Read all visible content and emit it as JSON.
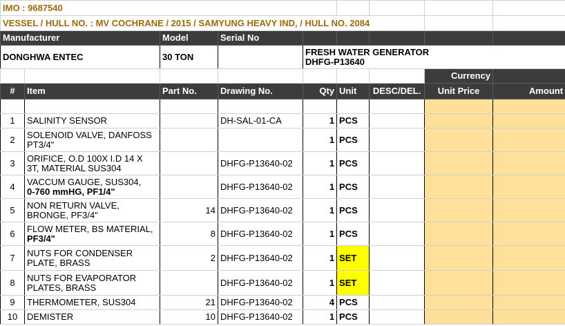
{
  "header": {
    "imo": "IMO : 9687540",
    "vessel": "VESSEL / HULL NO. : MV COCHRANE / 2015 / SAMYUNG HEAVY IND, / HULL NO. 2084"
  },
  "equipment_headers": {
    "manufacturer": "Manufacturer",
    "model": "Model",
    "serial": "Serial No"
  },
  "equipment": {
    "manufacturer": "DONGHWA ENTEC",
    "model": "30 TON",
    "serial": "",
    "description_line1": "FRESH WATER GENERATOR",
    "description_line2": "DHFG-P13640"
  },
  "currency_label": "Currency",
  "columns": {
    "num": "#",
    "item": "Item",
    "part": "Part No.",
    "drawing": "Drawing No.",
    "qty": "Qty",
    "unit": "Unit",
    "desc": "DESC/DEL.",
    "unit_price": "Unit Price",
    "amount": "Amount"
  },
  "rows": [
    {
      "num": "1",
      "item_line1": "SALINITY SENSOR",
      "item_line2": "",
      "part": "",
      "drawing": "DH-SAL-01-CA",
      "qty": "1",
      "unit": "PCS",
      "highlight": false
    },
    {
      "num": "2",
      "item_line1": "SOLENOID VALVE, DANFOSS",
      "item_line2": "PT3/4\"",
      "part": "",
      "drawing": "",
      "qty": "1",
      "unit": "PCS",
      "highlight": false
    },
    {
      "num": "3",
      "item_line1": "ORIFICE, O.D 100X I.D 14 X",
      "item_line2": "3T, MATERIAL SUS304",
      "part": "",
      "drawing": "DHFG-P13640-02",
      "qty": "1",
      "unit": "PCS",
      "highlight": false
    },
    {
      "num": "4",
      "item_line1": "VACCUM GAUGE, SUS304,",
      "item_line2": "0-760 mmHG, PF1/4\"",
      "part": "",
      "drawing": "DHFG-P13640-02",
      "qty": "1",
      "unit": "PCS",
      "highlight": false,
      "line2_bold": true
    },
    {
      "num": "5",
      "item_line1": "NON RETURN VALVE,",
      "item_line2": "BRONGE, PF3/4\"",
      "part": "14",
      "drawing": "DHFG-P13640-02",
      "qty": "1",
      "unit": "PCS",
      "highlight": false
    },
    {
      "num": "6",
      "item_line1": "FLOW METER, BS MATERIAL,",
      "item_line2": "PF3/4\"",
      "part": "8",
      "drawing": "DHFG-P13640-02",
      "qty": "1",
      "unit": "PCS",
      "highlight": false,
      "line2_bold": true
    },
    {
      "num": "7",
      "item_line1": "NUTS FOR CONDENSER",
      "item_line2": "PLATE, BRASS",
      "part": "2",
      "drawing": "DHFG-P13640-02",
      "qty": "1",
      "unit": "SET",
      "highlight": true
    },
    {
      "num": "8",
      "item_line1": "NUTS FOR EVAPORATOR",
      "item_line2": "PLATES, BRASS",
      "part": "",
      "drawing": "DHFG-P13640-02",
      "qty": "1",
      "unit": "SET",
      "highlight": true
    },
    {
      "num": "9",
      "item_line1": "THERMOMETER, SUS304",
      "item_line2": "",
      "part": "21",
      "drawing": "DHFG-P13640-02",
      "qty": "4",
      "unit": "PCS",
      "highlight": false
    },
    {
      "num": "10",
      "item_line1": "DEMISTER",
      "item_line2": "",
      "part": "10",
      "drawing": "DHFG-P13640-02",
      "qty": "1",
      "unit": "PCS",
      "highlight": false
    }
  ]
}
